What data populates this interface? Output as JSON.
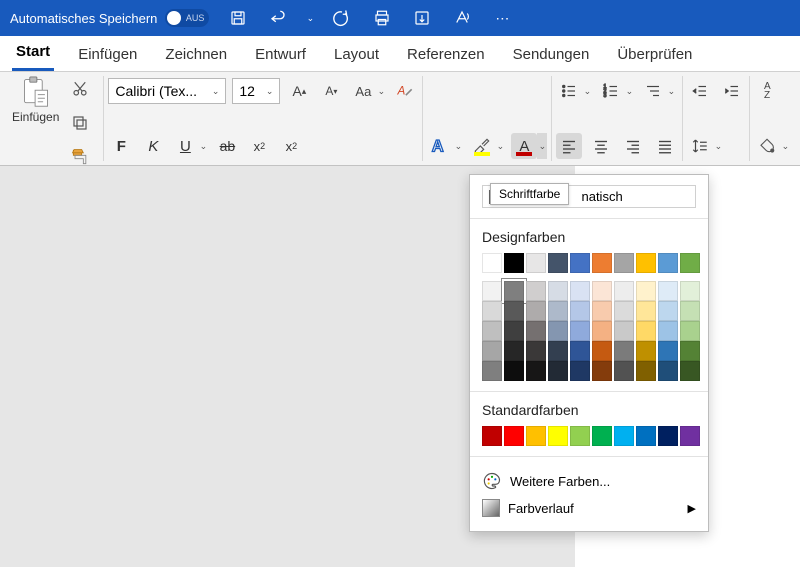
{
  "titlebar": {
    "autosave_label": "Automatisches Speichern",
    "autosave_state": "AUS"
  },
  "tabs": [
    "Start",
    "Einfügen",
    "Zeichnen",
    "Entwurf",
    "Layout",
    "Referenzen",
    "Sendungen",
    "Überprüfen"
  ],
  "active_tab": 0,
  "paste_label": "Einfügen",
  "font": {
    "name": "Calibri (Tex...",
    "size": "12"
  },
  "font_row_top": [
    "grow-font",
    "shrink-font",
    "change-case",
    "clear-format"
  ],
  "font_row_bot": [
    "bold",
    "italic",
    "underline",
    "strike",
    "subscript",
    "superscript"
  ],
  "text_effects_color": "#185abd",
  "highlight_color": "#ffff00",
  "font_color": "#c00000",
  "sortAZ": "A\nZ",
  "popup": {
    "auto_label": "natisch",
    "tooltip": "Schriftfarbe",
    "design_title": "Designfarben",
    "theme_row": [
      "#ffffff",
      "#000000",
      "#e7e6e6",
      "#44546a",
      "#4472c4",
      "#ed7d31",
      "#a5a5a5",
      "#ffc000",
      "#5b9bd5",
      "#70ad47"
    ],
    "shades": [
      [
        "#f2f2f2",
        "#7f7f7f",
        "#d0cece",
        "#d6dce5",
        "#d9e2f3",
        "#fbe5d6",
        "#ededed",
        "#fff2cc",
        "#deebf7",
        "#e2f0d9"
      ],
      [
        "#d9d9d9",
        "#595959",
        "#aeabab",
        "#adb9ca",
        "#b4c7e7",
        "#f8cbad",
        "#dbdbdb",
        "#ffe699",
        "#bdd7ee",
        "#c5e0b4"
      ],
      [
        "#bfbfbf",
        "#3f3f3f",
        "#757070",
        "#8496b0",
        "#8faadc",
        "#f4b183",
        "#c9c9c9",
        "#ffd966",
        "#9dc3e6",
        "#a9d18e"
      ],
      [
        "#a6a6a6",
        "#262626",
        "#3a3838",
        "#333f50",
        "#2f5597",
        "#c55a11",
        "#7b7b7b",
        "#bf9000",
        "#2e75b6",
        "#548235"
      ],
      [
        "#7f7f7f",
        "#0d0d0d",
        "#171616",
        "#222a35",
        "#1f3864",
        "#843c0c",
        "#525252",
        "#806000",
        "#1f4e79",
        "#385723"
      ]
    ],
    "selected_shade": [
      0,
      1
    ],
    "standard_title": "Standardfarben",
    "standard": [
      "#c00000",
      "#ff0000",
      "#ffc000",
      "#ffff00",
      "#92d050",
      "#00b050",
      "#00b0f0",
      "#0070c0",
      "#002060",
      "#7030a0"
    ],
    "more_colors": "Weitere Farben...",
    "gradient": "Farbverlauf"
  }
}
